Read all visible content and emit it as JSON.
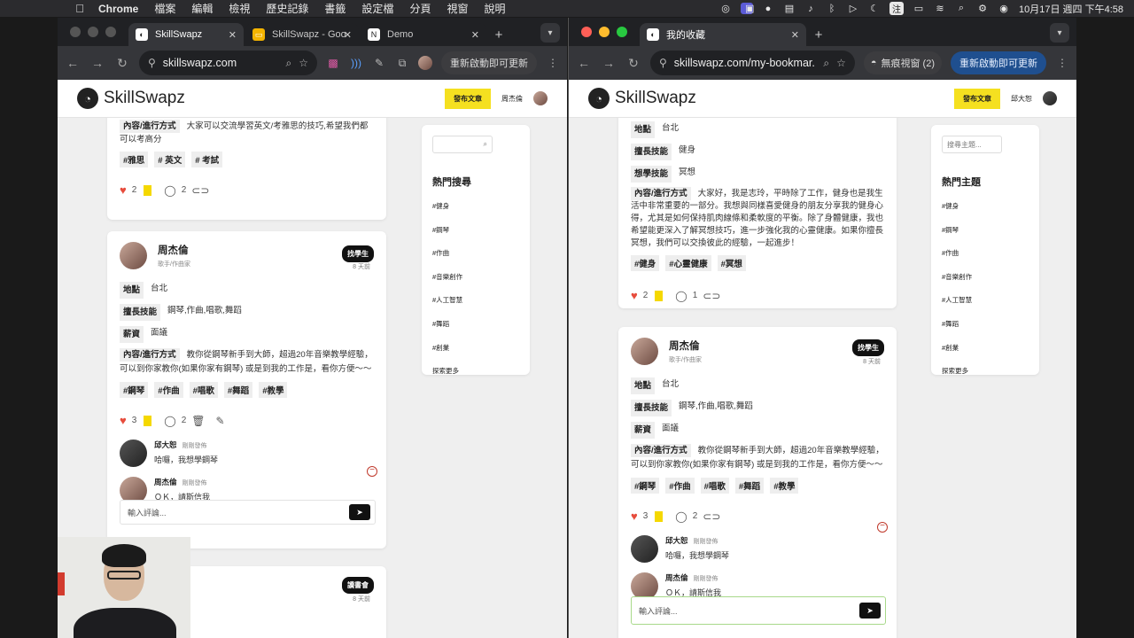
{
  "menubar": {
    "app": "Chrome",
    "items": [
      "檔案",
      "編輯",
      "檢視",
      "歷史記錄",
      "書籤",
      "設定檔",
      "分頁",
      "視窗",
      "說明"
    ],
    "ime": "注",
    "clock": "10月17日 週四 下午4:58"
  },
  "left_window": {
    "tabs": [
      {
        "title": "SkillSwapz",
        "active": true
      },
      {
        "title": "SkillSwapz - Goo",
        "active": false
      },
      {
        "title": "Demo",
        "active": false
      }
    ],
    "url": "skillswapz.com",
    "update_label": "重新啟動即可更新"
  },
  "right_window": {
    "tabs": [
      {
        "title": "我的收藏",
        "active": true
      }
    ],
    "url": "skillswapz.com/my-bookmar...",
    "incognito_label": "無痕視窗 (2)",
    "update_label": "重新啟動即可更新"
  },
  "site": {
    "logo": "SkillSwapz",
    "post_button": "發布文章",
    "left_user": "周杰倫",
    "right_user": "邱大恕"
  },
  "labels": {
    "location": "地點",
    "skills": "擅長技能",
    "salary": "薪資",
    "content": "內容/進行方式",
    "comment_placeholder": "輸入評論..."
  },
  "left_feed": {
    "partial_post": {
      "content": "大家可以交流學習英文/考雅思的技巧,希望我們都可以考高分",
      "tags": [
        "#雅思",
        "# 英文",
        "# 考試"
      ],
      "likes": "2",
      "comments": "2"
    },
    "post": {
      "author": "周杰倫",
      "subtitle": "歌手/作曲家",
      "badge": "找學生",
      "time": "8 天前",
      "location": "台北",
      "skills": "鋼琴,作曲,唱歌,舞蹈",
      "salary": "面議",
      "content": "教你從鋼琴新手到大師，超過20年音樂教學經驗，可以到你家教你(如果你家有鋼琴) 或是到我的工作是，看你方便～～",
      "tags": [
        "#鋼琴",
        "#作曲",
        "#唱歌",
        "#舞蹈",
        "#教學"
      ],
      "likes": "3",
      "comments": "2",
      "comment_list": [
        {
          "name": "邱大恕",
          "time": "剛剛發佈",
          "text": "哈囉，我想學鋼琴"
        },
        {
          "name": "周杰倫",
          "time": "剛剛發佈",
          "text": "ＯＫ，請斯信我"
        }
      ]
    },
    "next_post": {
      "badge": "讀書會",
      "time": "8 天前"
    }
  },
  "left_sidebar": {
    "search_placeholder": "",
    "title": "熱門搜尋",
    "items": [
      "#健身",
      "#鋼琴",
      "#作曲",
      "#音樂創作",
      "#人工智慧",
      "#舞蹈",
      "#創業",
      "探索更多"
    ]
  },
  "right_feed": {
    "partial_post": {
      "location": "台北",
      "skills": "健身",
      "want_label": "想學技能",
      "want": "冥想",
      "content": "大家好，我是志玲，平時除了工作，健身也是我生活中非常重要的一部分。我想與同樣喜愛健身的朋友分享我的健身心得，尤其是如何保持肌肉線條和柔軟度的平衡。除了身體健康，我也希望能更深入了解冥想技巧，進一步強化我的心靈健康。如果你擅長冥想，我們可以交換彼此的經驗，一起進步！",
      "tags": [
        "#健身",
        "#心靈健康",
        "#冥想"
      ],
      "likes": "2",
      "comments": "1"
    },
    "post": {
      "author": "周杰倫",
      "subtitle": "歌手/作曲家",
      "badge": "找學生",
      "time": "8 天前",
      "location": "台北",
      "skills": "鋼琴,作曲,唱歌,舞蹈",
      "salary": "面議",
      "content": "教你從鋼琴新手到大師，超過20年音樂教學經驗，可以到你家教你(如果你家有鋼琴) 或是到我的工作是，看你方便～～",
      "tags": [
        "#鋼琴",
        "#作曲",
        "#唱歌",
        "#舞蹈",
        "#教學"
      ],
      "likes": "3",
      "comments": "2",
      "comment_list": [
        {
          "name": "邱大恕",
          "time": "剛剛發佈",
          "text": "哈囉，我想學鋼琴"
        },
        {
          "name": "周杰倫",
          "time": "剛剛發佈",
          "text": "ＯＫ，請斯信我"
        }
      ]
    }
  },
  "right_sidebar": {
    "search_placeholder": "搜尋主題...",
    "title": "熱門主題",
    "items": [
      "#健身",
      "#鋼琴",
      "#作曲",
      "#音樂創作",
      "#人工智慧",
      "#舞蹈",
      "#創業",
      "探索更多"
    ]
  }
}
